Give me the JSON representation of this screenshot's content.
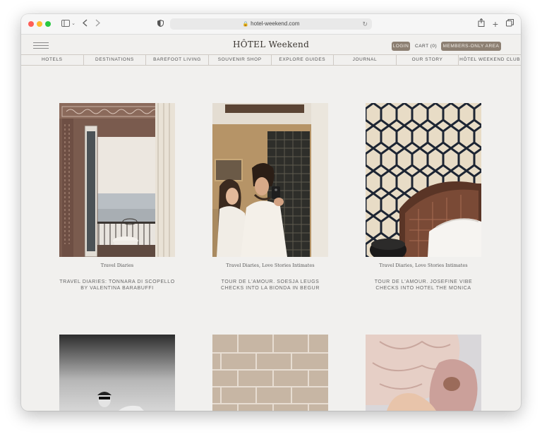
{
  "browser": {
    "url": "hotel-weekend.com"
  },
  "header": {
    "logo": "HÔTEL Weekend",
    "login": "LOGIN",
    "cart": "CART (0)",
    "members": "MEMBERS-ONLY AREA"
  },
  "nav": [
    "HOTELS",
    "DESTINATIONS",
    "BAREFOOT LIVING",
    "SOUVENIR SHOP",
    "EXPLORE GUIDES",
    "JOURNAL",
    "OUR STORY",
    "HÔTEL WEEKEND CLUB"
  ],
  "articles": [
    {
      "category": "Travel Diaries",
      "title_line1": "TRAVEL DIARIES: TONNARA DI SCOPELLO",
      "title_line2": "BY VALENTINA BARABUFFI"
    },
    {
      "category": "Travel Diaries, Love Stories Intimates",
      "title_line1": "TOUR DE L'AMOUR. SOESJA LEUGS",
      "title_line2": "CHECKS INTO LA BIONDA IN BEGUR"
    },
    {
      "category": "Travel Diaries, Love Stories Intimates",
      "title_line1": "TOUR DE L'AMOUR. JOSEFINE VIBE",
      "title_line2": "CHECKS INTO HOTEL THE MONICA"
    }
  ],
  "colors": {
    "page_bg": "#f1f0ee",
    "pill_bg": "#8c7f72"
  },
  "icons": {
    "sidebar": "sidebar-icon",
    "back": "chevron-left-icon",
    "forward": "chevron-right-icon",
    "privacy": "shield-icon",
    "lock": "lock-icon",
    "reload": "reload-icon",
    "share": "share-icon",
    "new_tab": "plus-icon",
    "tabs": "tabs-icon",
    "menu": "hamburger-icon"
  }
}
